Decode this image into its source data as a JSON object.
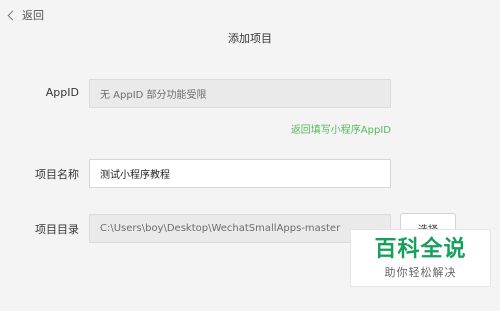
{
  "header": {
    "back_label": "返回",
    "title": "添加项目"
  },
  "form": {
    "appid": {
      "label": "AppID",
      "value": "无 AppID 部分功能受限"
    },
    "appid_link": "返回填写小程序AppID",
    "project_name": {
      "label": "项目名称",
      "value": "测试小程序教程"
    },
    "project_dir": {
      "label": "项目目录",
      "value": "C:\\Users\\boy\\Desktop\\WechatSmallApps-master",
      "button_label": "选择"
    }
  },
  "watermark": {
    "title": "百科全说",
    "subtitle": "助你轻松解决"
  }
}
